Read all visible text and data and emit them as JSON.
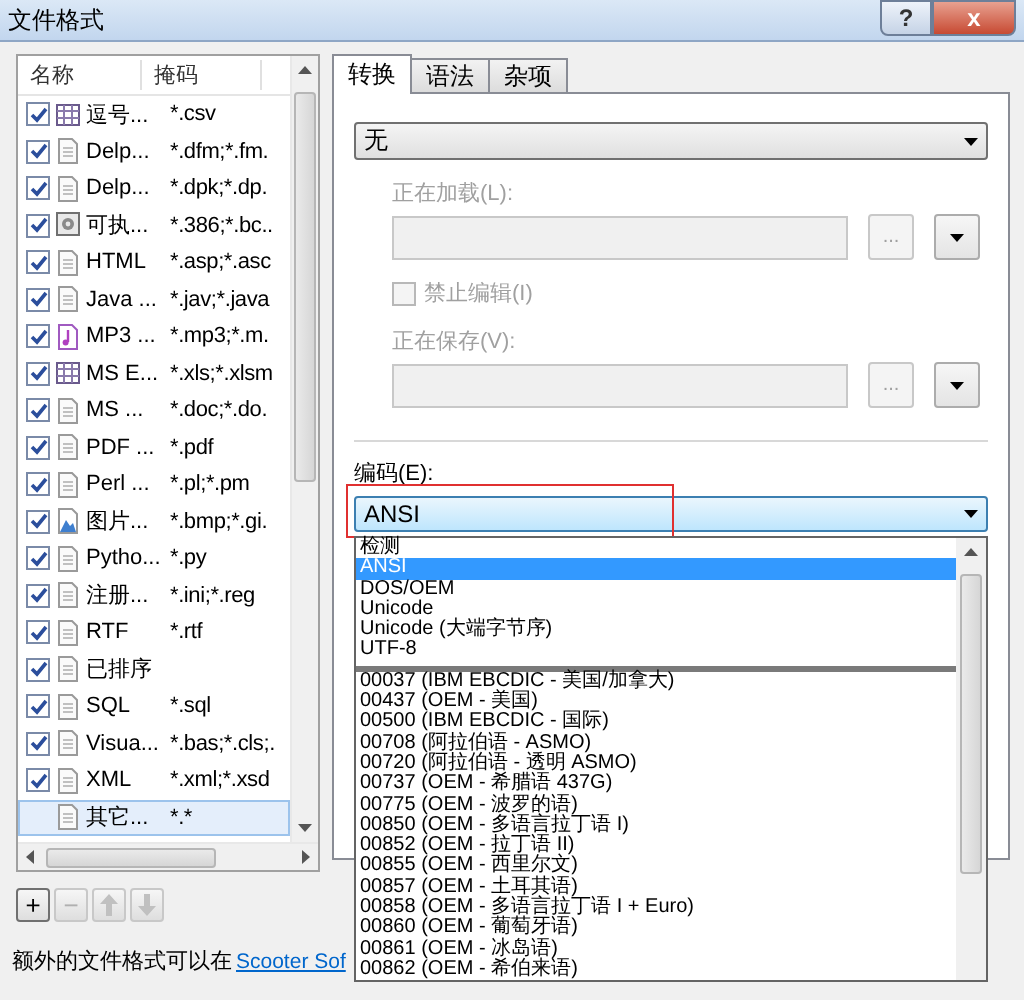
{
  "window": {
    "title": "文件格式",
    "help": "?",
    "close": "x"
  },
  "file_types": {
    "columns": [
      "名称",
      "掩码"
    ],
    "rows": [
      {
        "kind": "spreadsheet",
        "checked": true,
        "selected": false,
        "name": "逗号...",
        "mask": "*.csv"
      },
      {
        "kind": "document",
        "checked": true,
        "selected": false,
        "name": "Delp...",
        "mask": "*.dfm;*.fm."
      },
      {
        "kind": "document",
        "checked": true,
        "selected": false,
        "name": "Delp...",
        "mask": "*.dpk;*.dp."
      },
      {
        "kind": "executable",
        "checked": true,
        "selected": false,
        "name": "可执...",
        "mask": "*.386;*.bc.."
      },
      {
        "kind": "document",
        "checked": true,
        "selected": false,
        "name": "HTML",
        "mask": "*.asp;*.asc"
      },
      {
        "kind": "document",
        "checked": true,
        "selected": false,
        "name": "Java ...",
        "mask": "*.jav;*.java"
      },
      {
        "kind": "audio",
        "checked": true,
        "selected": false,
        "name": "MP3 ...",
        "mask": "*.mp3;*.m."
      },
      {
        "kind": "spreadsheet",
        "checked": true,
        "selected": false,
        "name": "MS E...",
        "mask": "*.xls;*.xlsm"
      },
      {
        "kind": "document",
        "checked": true,
        "selected": false,
        "name": "MS ...",
        "mask": "*.doc;*.do."
      },
      {
        "kind": "document",
        "checked": true,
        "selected": false,
        "name": "PDF ...",
        "mask": "*.pdf"
      },
      {
        "kind": "document",
        "checked": true,
        "selected": false,
        "name": "Perl ...",
        "mask": "*.pl;*.pm"
      },
      {
        "kind": "image",
        "checked": true,
        "selected": false,
        "name": "图片...",
        "mask": "*.bmp;*.gi."
      },
      {
        "kind": "document",
        "checked": true,
        "selected": false,
        "name": "Pytho...",
        "mask": "*.py"
      },
      {
        "kind": "document",
        "checked": true,
        "selected": false,
        "name": "注册...",
        "mask": "*.ini;*.reg"
      },
      {
        "kind": "document",
        "checked": true,
        "selected": false,
        "name": "RTF",
        "mask": "*.rtf"
      },
      {
        "kind": "document",
        "checked": true,
        "selected": false,
        "name": "已排序"
      },
      {
        "kind": "document",
        "checked": true,
        "selected": false,
        "name": "SQL",
        "mask": "*.sql"
      },
      {
        "kind": "document",
        "checked": true,
        "selected": false,
        "name": "Visua...",
        "mask": "*.bas;*.cls;."
      },
      {
        "kind": "document",
        "checked": true,
        "selected": false,
        "name": "XML",
        "mask": "*.xml;*.xsd"
      },
      {
        "kind": "document",
        "selected": true,
        "name": "其它...",
        "mask": "*.*"
      }
    ]
  },
  "list_buttons": [
    {
      "kind": "text",
      "label": "+",
      "disabled": false
    },
    {
      "kind": "text",
      "label": "−",
      "disabled": true
    },
    {
      "kind": "up",
      "disabled": true
    },
    {
      "kind": "down",
      "disabled": true
    }
  ],
  "tabs": [
    {
      "label": "转换",
      "selected": true
    },
    {
      "label": "语法",
      "selected": false
    },
    {
      "label": "杂项",
      "selected": false
    }
  ],
  "converter": {
    "value": "无"
  },
  "loading": {
    "label": "正在加载(L):",
    "browse": "...",
    "disabled": true
  },
  "lock_edit": {
    "label": "禁止编辑(I)",
    "checked": false,
    "disabled": true
  },
  "saving": {
    "label": "正在保存(V):",
    "browse": "...",
    "disabled": true
  },
  "encoding": {
    "label": "编码(E):",
    "value": "ANSI",
    "highlighted": true,
    "option_groups": [
      [
        {
          "label": "检测",
          "selected": false
        },
        {
          "label": "ANSI",
          "selected": true
        },
        {
          "label": "DOS/OEM",
          "selected": false
        },
        {
          "label": "Unicode",
          "selected": false
        },
        {
          "label": "Unicode (大端字节序)",
          "selected": false
        },
        {
          "label": "UTF-8",
          "selected": false
        }
      ],
      [
        {
          "label": "00037  (IBM EBCDIC - 美国/加拿大)",
          "selected": false
        },
        {
          "label": "00437  (OEM - 美国)",
          "selected": false
        },
        {
          "label": "00500  (IBM EBCDIC - 国际)",
          "selected": false
        },
        {
          "label": "00708  (阿拉伯语 - ASMO)",
          "selected": false
        },
        {
          "label": "00720  (阿拉伯语 - 透明 ASMO)",
          "selected": false
        },
        {
          "label": "00737  (OEM - 希腊语 437G)",
          "selected": false
        },
        {
          "label": "00775  (OEM - 波罗的语)",
          "selected": false
        },
        {
          "label": "00850  (OEM - 多语言拉丁语 I)",
          "selected": false
        },
        {
          "label": "00852  (OEM - 拉丁语 II)",
          "selected": false
        },
        {
          "label": "00855  (OEM - 西里尔文)",
          "selected": false
        },
        {
          "label": "00857  (OEM - 土耳其语)",
          "selected": false
        },
        {
          "label": "00858  (OEM - 多语言拉丁语 I + Euro)",
          "selected": false
        },
        {
          "label": "00860  (OEM - 葡萄牙语)",
          "selected": false
        },
        {
          "label": "00861  (OEM - 冰岛语)",
          "selected": false
        },
        {
          "label": "00862  (OEM - 希伯来语)",
          "selected": false
        }
      ]
    ]
  },
  "footer": {
    "text": "额外的文件格式可以在",
    "link": "Scooter Sof"
  }
}
